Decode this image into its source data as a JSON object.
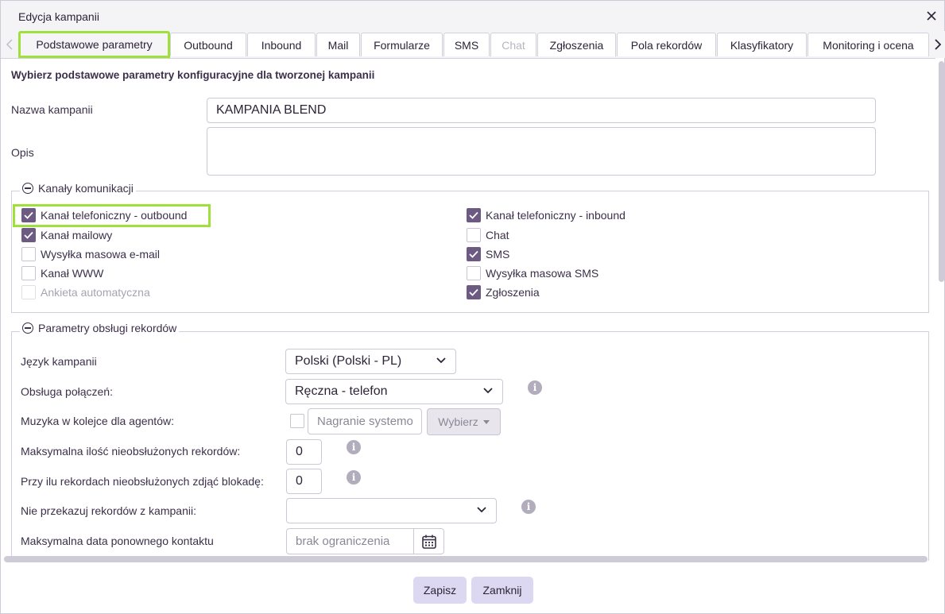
{
  "dialog": {
    "title": "Edycja kampanii"
  },
  "tabs": [
    {
      "label": "Podstawowe parametry",
      "active": true
    },
    {
      "label": "Outbound"
    },
    {
      "label": "Inbound"
    },
    {
      "label": "Mail"
    },
    {
      "label": "Formularze"
    },
    {
      "label": "SMS"
    },
    {
      "label": "Chat",
      "disabled": true
    },
    {
      "label": "Zgłoszenia"
    },
    {
      "label": "Pola rekordów"
    },
    {
      "label": "Klasyfikatory"
    },
    {
      "label": "Monitoring i ocena"
    }
  ],
  "intro": "Wybierz podstawowe parametry konfiguracyjne dla tworzonej kampanii",
  "fields": {
    "name_label": "Nazwa kampanii",
    "name_value": "KAMPANIA BLEND",
    "desc_label": "Opis",
    "desc_value": ""
  },
  "channels": {
    "legend": "Kanały komunikacji",
    "left": [
      {
        "label": "Kanał telefoniczny - outbound",
        "checked": true
      },
      {
        "label": "Kanał mailowy",
        "checked": true
      },
      {
        "label": "Wysyłka masowa e-mail",
        "checked": false
      },
      {
        "label": "Kanał WWW",
        "checked": false
      },
      {
        "label": "Ankieta automatyczna",
        "checked": false,
        "disabled": true
      }
    ],
    "right": [
      {
        "label": "Kanał telefoniczny - inbound",
        "checked": true
      },
      {
        "label": "Chat",
        "checked": false
      },
      {
        "label": "SMS",
        "checked": true
      },
      {
        "label": "Wysyłka masowa SMS",
        "checked": false
      },
      {
        "label": "Zgłoszenia",
        "checked": true
      }
    ]
  },
  "records": {
    "legend": "Parametry obsługi rekordów",
    "language_label": "Język kampanii",
    "language_value": "Polski (Polski - PL)",
    "connection_label": "Obsługa połączeń:",
    "connection_value": "Ręczna - telefon",
    "music_label": "Muzyka w kolejce dla agentów:",
    "music_placeholder": "Nagranie systemowe",
    "music_button": "Wybierz",
    "max_unhandled_label": "Maksymalna ilość nieobsłużonych rekordów:",
    "max_unhandled_value": "0",
    "unlock_label": "Przy ilu rekordach nieobsłużonych zdjąć blokadę:",
    "unlock_value": "0",
    "no_transfer_label": "Nie przekazuj rekordów z kampanii:",
    "no_transfer_value": "",
    "max_date_label": "Maksymalna data ponownego kontaktu",
    "max_date_placeholder": "brak ograniczenia"
  },
  "footer": {
    "save": "Zapisz",
    "close": "Zamknij"
  },
  "colors": {
    "accent_highlight": "#9fe03a",
    "checkbox_checked": "#6d5a83",
    "button_bg": "#dcd8f2"
  }
}
